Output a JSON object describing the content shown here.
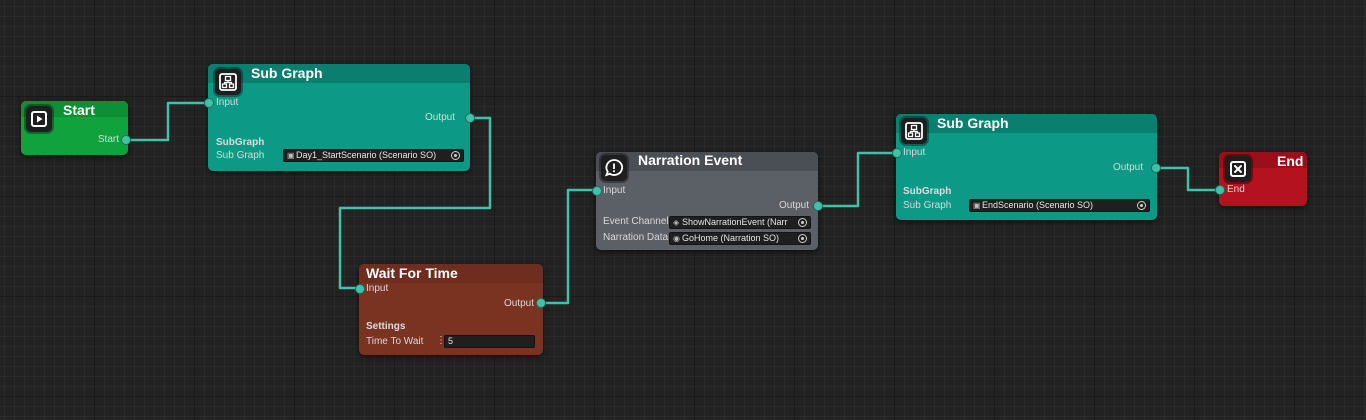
{
  "start": {
    "title": "Start",
    "out_label": "Start"
  },
  "subgraph1": {
    "title": "Sub Graph",
    "in_label": "Input",
    "out_label": "Output",
    "section": "SubGraph",
    "field_label": "Sub Graph",
    "field_value": "Day1_StartScenario (Scenario SO)"
  },
  "wait": {
    "title": "Wait For Time",
    "in_label": "Input",
    "out_label": "Output",
    "section": "Settings",
    "field_label": "Time To Wait",
    "field_value": "5"
  },
  "narration": {
    "title": "Narration Event",
    "in_label": "Input",
    "out_label": "Output",
    "channel_label": "Event Channel",
    "channel_value": "ShowNarrationEvent (Narr",
    "data_label": "Narration Data",
    "data_value": "GoHome (Narration SO)"
  },
  "subgraph2": {
    "title": "Sub Graph",
    "in_label": "Input",
    "out_label": "Output",
    "section": "SubGraph",
    "field_label": "Sub Graph",
    "field_value": "EndScenario (Scenario SO)"
  },
  "end": {
    "title": "End",
    "in_label": "End"
  },
  "colors": {
    "start": "#10a33d",
    "subgraph": "#0c9a86",
    "wait": "#7a3221",
    "narration": "#5b5f66",
    "end": "#b3121e",
    "wire": "#3fc3a8"
  },
  "icons": {
    "start": "play-icon",
    "subgraph": "subgraph-icon",
    "narration": "speech-bubble-icon",
    "end": "close-icon"
  }
}
